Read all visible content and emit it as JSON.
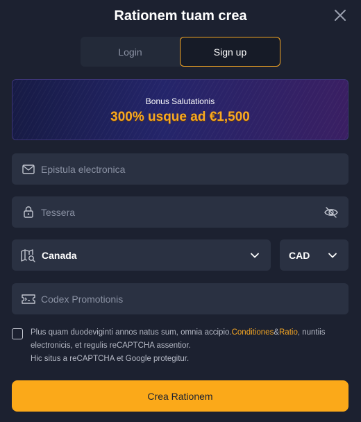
{
  "header": {
    "title": "Rationem tuam crea"
  },
  "tabs": [
    {
      "label": "Login",
      "active": false
    },
    {
      "label": "Sign up",
      "active": true
    }
  ],
  "bonus": {
    "label": "Bonus Salutationis",
    "amount": "300% usque ad €1,500"
  },
  "form": {
    "email_placeholder": "Epistula electronica",
    "password_placeholder": "Tessera",
    "country_value": "Canada",
    "currency_value": "CAD",
    "promo_placeholder": "Codex Promotionis"
  },
  "terms": {
    "text_before": "Plus quam duodeviginti annos natus sum, omnia accipio.",
    "conditions_link": "Conditiones",
    "ampersand": "&",
    "ratio_link": "Ratio",
    "text_after": ", nuntiis electronicis, et regulis reCAPTCHA assentior.",
    "recaptcha_note": "Hic situs a reCAPTCHA et Google protegitur."
  },
  "submit_label": "Crea Rationem",
  "colors": {
    "background": "#1c2130",
    "field": "#2a3142",
    "accent": "#f5a623",
    "button": "#fba919"
  },
  "icons": [
    "close-icon",
    "envelope-icon",
    "lock-icon",
    "eye-off-icon",
    "map-search-icon",
    "chevron-down-icon",
    "ticket-icon"
  ]
}
